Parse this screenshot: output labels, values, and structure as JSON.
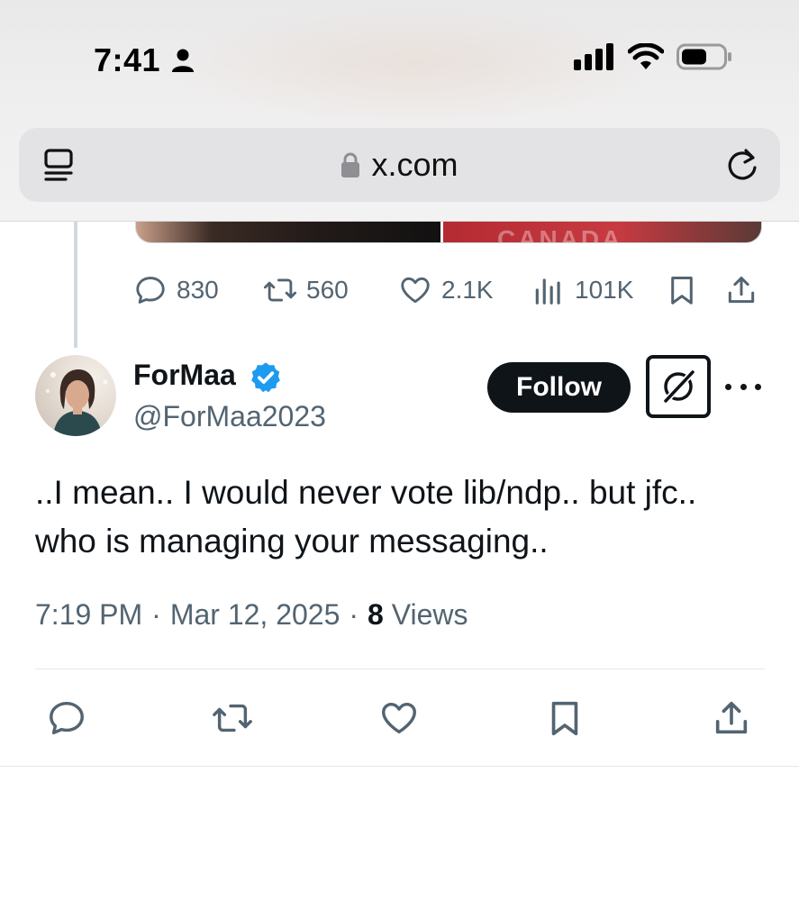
{
  "status_bar": {
    "time": "7:41",
    "icons": [
      "person-icon",
      "cellular-signal-icon",
      "wifi-icon",
      "battery-icon"
    ]
  },
  "browser": {
    "url": "x.com",
    "icons": [
      "reader-icon",
      "lock-icon",
      "reload-icon"
    ]
  },
  "previous_tweet": {
    "stats": {
      "replies": "830",
      "reposts": "560",
      "likes": "2.1K",
      "views": "101K"
    }
  },
  "tweet": {
    "author_name": "ForMaa",
    "author_handle": "@ForMaa2023",
    "verified": true,
    "follow_label": "Follow",
    "text": "..I mean.. I would never vote lib/ndp.. but jfc.. who is managing your messaging..",
    "time": "7:19 PM",
    "separator": "·",
    "date": "Mar 12, 2025",
    "views_count": "8",
    "views_label": "Views"
  },
  "colors": {
    "text_primary": "#0f1419",
    "text_secondary": "#536471",
    "verified_blue": "#1d9bf0",
    "divider": "#e1e8ed"
  }
}
